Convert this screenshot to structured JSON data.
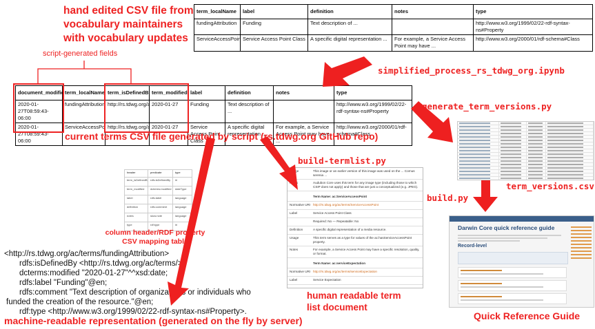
{
  "title_hand_edited": [
    "hand edited CSV file from",
    "vocabulary maintainers",
    "with vocabulary updates"
  ],
  "script_generated_fields": "script-generated fields",
  "top_table": {
    "headers": [
      "term_localName",
      "label",
      "definition",
      "notes",
      "type"
    ],
    "rows": [
      [
        "fundingAttribution",
        "Funding",
        "Text description of ...",
        "",
        "http://www.w3.org/1999/02/22-rdf-syntax-ns#Property"
      ],
      [
        "ServiceAccessPoint",
        "Service Access Point Class",
        "A specific digital representation ...",
        "For example, a Service Access Point may have ...",
        "http://www.w3.org/2000/01/rdf-schema#Class"
      ]
    ]
  },
  "main_table": {
    "headers": [
      "document_modified",
      "term_localName",
      "term_isDefinedBy",
      "term_modified",
      "label",
      "definition",
      "notes",
      "type"
    ],
    "rows": [
      [
        "2020-01-27T08:59:43-06:00",
        "fundingAttribution",
        "http://rs.tdwg.org/ac/terms/",
        "2020-01-27",
        "Funding",
        "Text description of ...",
        "",
        "http://www.w3.org/1999/02/22-rdf-syntax-ns#Property"
      ],
      [
        "2020-01-27T08:59:43-06:00",
        "ServiceAccessPoint",
        "http://rs.tdwg.org/ac/terms/",
        "2020-01-27",
        "Service Access Point Class",
        "A specific digital representation ...",
        "For example, a Service Access Point may have ...",
        "http://www.w3.org/2000/01/rdf-schema#Class"
      ]
    ]
  },
  "caption_current_terms": "current terms CSV file generated by script (rs.tdwg.org GitHub repo)",
  "script_simplified": "simplified_process_rs_tdwg_org.ipynb",
  "script_generate_versions": "generate_term_versions.py",
  "script_build_termlist": "build-termlist.py",
  "label_term_versions": "term_versions.csv",
  "script_build": "build.py",
  "label_mapping_table": [
    "column header/RDF property",
    "CSV mapping table"
  ],
  "mapping_table": {
    "headers": [
      "header",
      "predicate",
      "type"
    ],
    "rows": [
      [
        "term_isDefinedBy",
        "rdfs:isDefinedBy",
        "iri"
      ],
      [
        "term_modified",
        "dcterms:modified",
        "dateType"
      ],
      [
        "label",
        "rdfs:label",
        "language"
      ],
      [
        "definition",
        "rdfs:comment",
        "language"
      ],
      [
        "notes",
        "skos:note",
        "language"
      ],
      [
        "type",
        "rdf:type",
        "iri"
      ]
    ]
  },
  "rdf_lines": [
    "<http://rs.tdwg.org/ac/terms/fundingAttribution>",
    "rdfs:isDefinedBy <http://rs.tdwg.org/ac/terms/>;",
    "dcterms:modified \"2020-01-27\"^^xsd:date;",
    "rdfs:label \"Funding\"@en;",
    "rdfs:comment \"Text description of organizations or individuals who",
    "funded the creation of the resource.\"@en;",
    "rdf:type <http://www.w3.org/1999/02/22-rdf-syntax-ns#Property>."
  ],
  "caption_machine_readable": "machine-readable representation (generated on the fly by server)",
  "caption_human_readable": [
    "human readable term",
    "list document"
  ],
  "caption_quick_reference": "Quick Reference Guide",
  "termlist_doc": {
    "rows": [
      [
        "Usage",
        "This image or an earlier version of this image was used on the ... Cornus serenia ..."
      ],
      [
        "Notes",
        "Audubon Core uses this term for any image type (including those to which CSIP does not apply) and those that are just a conceptualized (e.g. JPEG)."
      ],
      [
        "",
        "Term Name: ac:ServiceAccessPoint"
      ],
      [
        "Normative URI",
        "http://rs.tdwg.org/ac/terms/ServiceAccessPoint"
      ],
      [
        "Label",
        "Service Access Point Class"
      ],
      [
        "",
        "Required: No — Repeatable: No"
      ],
      [
        "Definition",
        "A specific digital representation of a media resource."
      ],
      [
        "Usage",
        "This term serves as a type for values of the ac:hasServiceAccessPoint property."
      ],
      [
        "Notes",
        "For example, a Service Access Point may have a specific resolution, quality, or format."
      ],
      [
        "",
        "Term Name: ac:serviceExpectation"
      ],
      [
        "Normative URI",
        "http://rs.tdwg.org/ac/terms/serviceExpectation"
      ],
      [
        "Label",
        "Service Expectation"
      ]
    ]
  },
  "quick_ref": {
    "title": "Darwin Core quick reference guide",
    "section": "Record-level"
  }
}
